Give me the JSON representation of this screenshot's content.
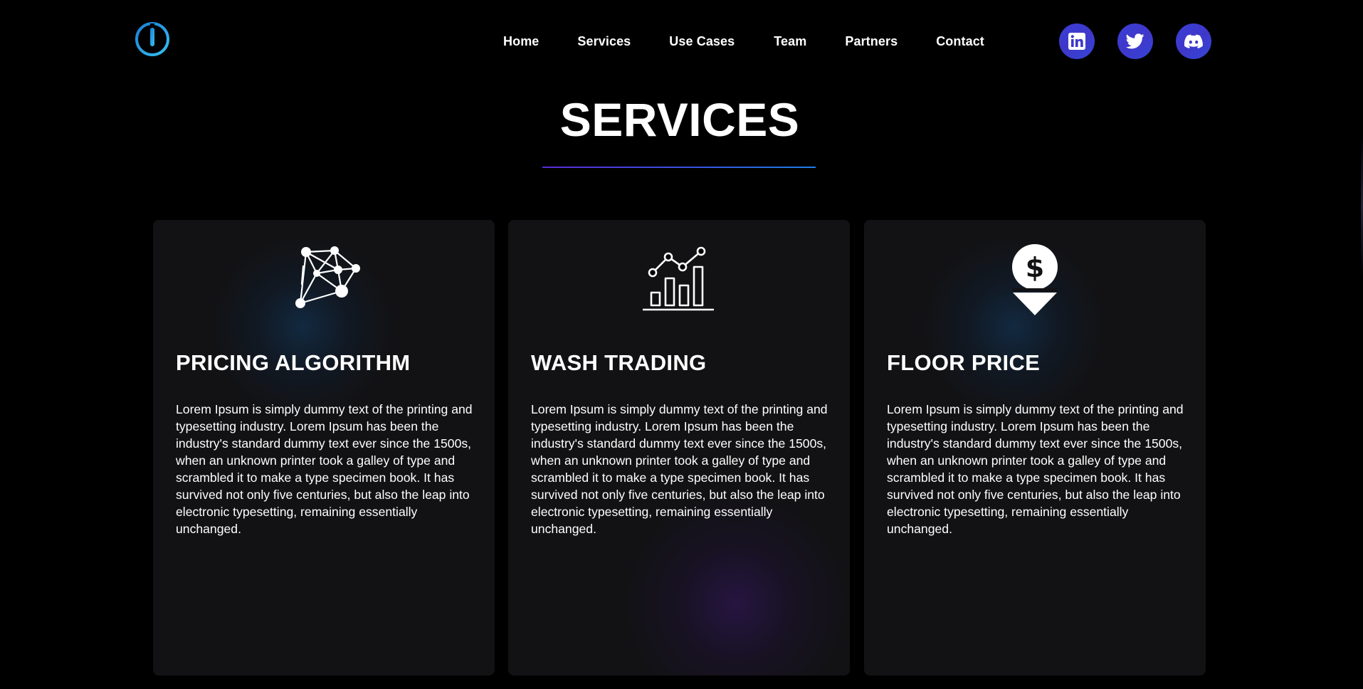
{
  "nav": {
    "logo_icon": "power-ring-logo",
    "links": [
      "Home",
      "Services",
      "Use Cases",
      "Team",
      "Partners",
      "Contact"
    ],
    "social": [
      {
        "name": "linkedin",
        "icon": "linkedin-icon"
      },
      {
        "name": "twitter",
        "icon": "twitter-icon"
      },
      {
        "name": "discord",
        "icon": "discord-icon"
      }
    ]
  },
  "section": {
    "title": "SERVICES"
  },
  "cards": [
    {
      "icon": "network-nodes-icon",
      "title": "PRICING ALGORITHM",
      "text": "Lorem Ipsum is simply dummy text of the printing and typesetting industry. Lorem Ipsum has been the industry's standard dummy text ever since the 1500s, when an unknown printer took a galley of type and scrambled it to make a type specimen book. It has survived not only five centuries, but also the leap into electronic typesetting, remaining essentially unchanged."
    },
    {
      "icon": "bar-chart-trend-icon",
      "title": "WASH TRADING",
      "text": "Lorem Ipsum is simply dummy text of the printing and typesetting industry. Lorem Ipsum has been the industry's standard dummy text ever since the 1500s, when an unknown printer took a galley of type and scrambled it to make a type specimen book. It has survived not only five centuries, but also the leap into electronic typesetting, remaining essentially unchanged."
    },
    {
      "icon": "dollar-down-arrow-icon",
      "title": "FLOOR PRICE",
      "text": "Lorem Ipsum is simply dummy text of the printing and typesetting industry. Lorem Ipsum has been the industry's standard dummy text ever since the 1500s, when an unknown printer took a galley of type and scrambled it to make a type specimen book. It has survived not only five centuries, but also the leap into electronic typesetting, remaining essentially unchanged."
    }
  ],
  "colors": {
    "background": "#000000",
    "card": "#121214",
    "social_button": "#3f37c9",
    "logo_accent": "#29a8ea",
    "underline_start": "#5b2bd8",
    "underline_end": "#1e7fe6"
  }
}
